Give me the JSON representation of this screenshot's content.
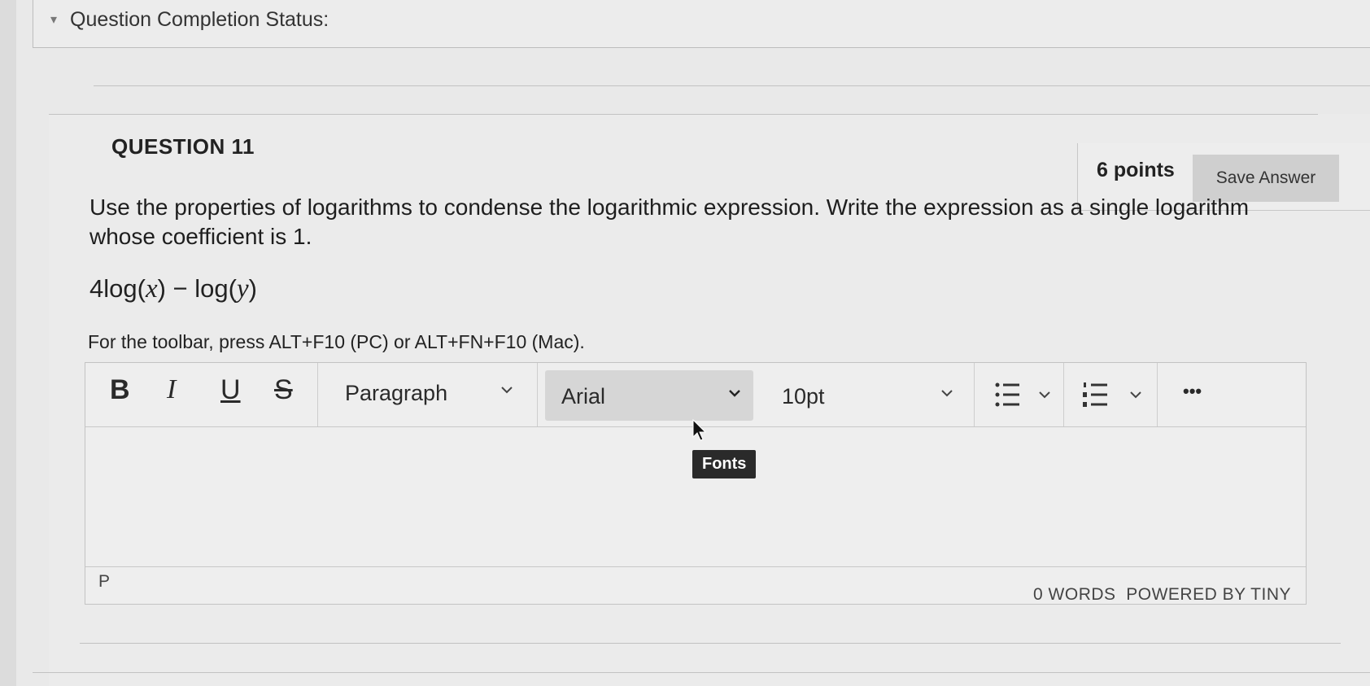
{
  "status": {
    "label": "Question Completion Status:"
  },
  "question": {
    "title": "QUESTION 11",
    "points": "6 points",
    "save_label": "Save Answer",
    "text": "Use the properties of logarithms to condense the logarithmic expression.  Write the expression as a single logarithm whose coefficient is 1.",
    "expression": {
      "coef": "4",
      "log1": "log(",
      "var1": "x",
      "close1": ")",
      "minus": " − ",
      "log2": "log(",
      "var2": "y",
      "close2": ")"
    }
  },
  "editor": {
    "hint": "For the toolbar, press ALT+F10 (PC) or ALT+FN+F10 (Mac).",
    "toolbar": {
      "bold": "B",
      "italic": "I",
      "underline": "U",
      "strike": "S",
      "block_format": "Paragraph",
      "font_family": "Arial",
      "font_size": "10pt",
      "more": "•••"
    },
    "tooltip": "Fonts",
    "path": "P",
    "word_count": "0 WORDS",
    "powered_by": "POWERED BY TINY"
  },
  "icons": {
    "status_toggle": "chevron-down-icon",
    "bullet_list": "bullet-list-icon",
    "numbered_list": "numbered-list-icon",
    "more": "more-icon",
    "pointer": "mouse-pointer-icon"
  }
}
